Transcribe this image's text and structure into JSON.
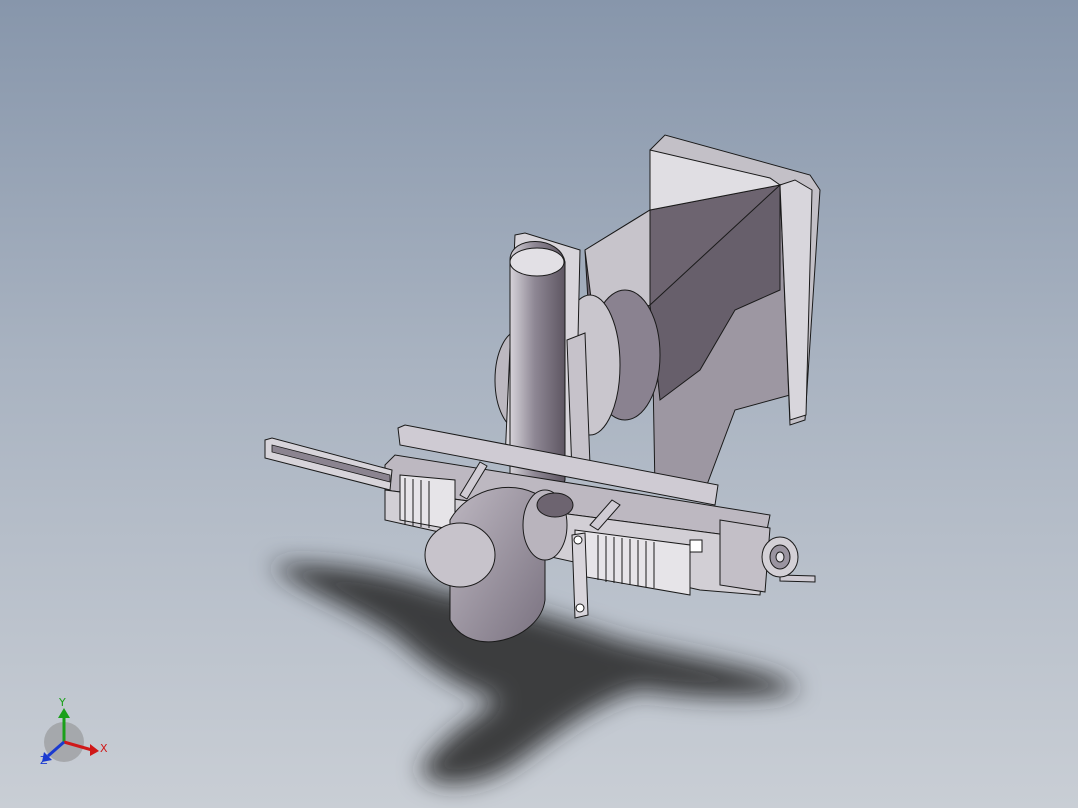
{
  "viewport": {
    "background_top": "#8796ab",
    "background_bottom": "#c9ced5",
    "model_fill": "#c9c6cc",
    "model_shade": "#6d6470",
    "model_edge": "#1a1a1a"
  },
  "triad": {
    "x_label": "X",
    "y_label": "Y",
    "z_label": "Z",
    "x_color": "#d01818",
    "y_color": "#1aa01a",
    "z_color": "#1a3ad0"
  }
}
